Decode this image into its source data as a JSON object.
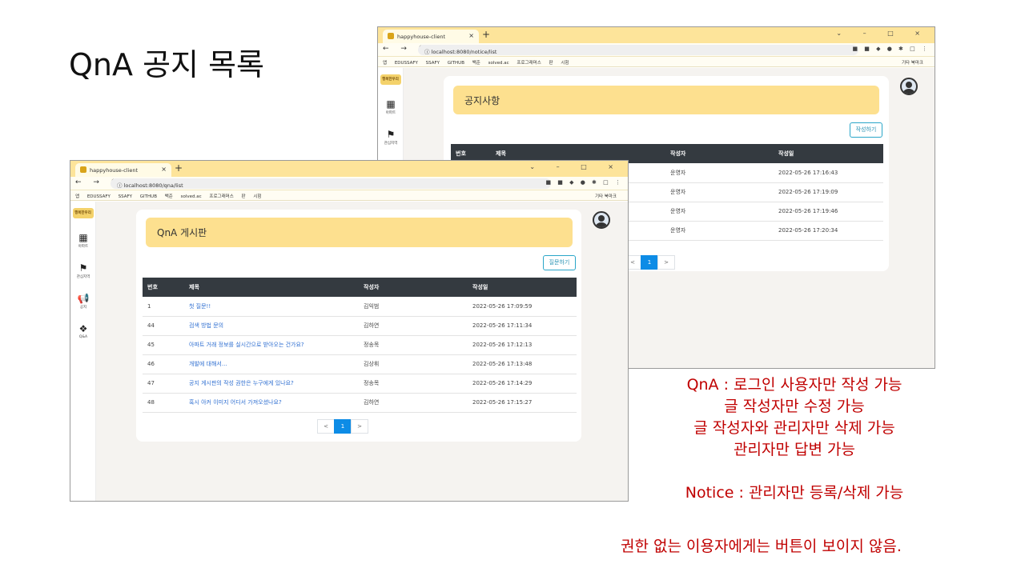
{
  "slide_title": "QnA 공지 목록",
  "notice_window": {
    "tab_title": "happyhouse-client",
    "url": "localhost:8080/notice/list",
    "bookmarks": [
      "앱",
      "EDUSSAFY",
      "SSAFY",
      "GITHUB",
      "백준",
      "solved.ac",
      "프로그래머스",
      "판",
      "시험"
    ],
    "bookmarks_right": "기타 북마크",
    "sidebar": [
      {
        "label": "아파트"
      },
      {
        "label": "관심지역"
      }
    ],
    "logo_text": "행복한우리",
    "heading": "공지사항",
    "action_button": "작성하기",
    "columns": [
      "번호",
      "제목",
      "작성자",
      "작성일"
    ],
    "rows": [
      {
        "author": "운영자",
        "date": "2022-05-26 17:16:43"
      },
      {
        "author": "운영자",
        "date": "2022-05-26 17:19:09"
      },
      {
        "author": "운영자",
        "date": "2022-05-26 17:19:46"
      },
      {
        "author": "운영자",
        "date": "2022-05-26 17:20:34"
      }
    ],
    "pager": {
      "prev": "<",
      "page": "1",
      "next": ">"
    }
  },
  "qna_window": {
    "tab_title": "happyhouse-client",
    "url": "localhost:8080/qna/list",
    "bookmarks": [
      "앱",
      "EDUSSAFY",
      "SSAFY",
      "GITHUB",
      "백준",
      "solved.ac",
      "프로그래머스",
      "판",
      "시험"
    ],
    "bookmarks_right": "기타 북마크",
    "sidebar": [
      {
        "label": "아파트"
      },
      {
        "label": "관심지역"
      },
      {
        "label": "공지"
      },
      {
        "label": "Q&A"
      }
    ],
    "logo_text": "행복한우리",
    "heading": "QnA 게시판",
    "action_button": "질문하기",
    "columns": [
      "번호",
      "제목",
      "작성자",
      "작성일"
    ],
    "rows": [
      {
        "no": "1",
        "title": "첫 질문!!",
        "author": "김익범",
        "date": "2022-05-26 17:09:59"
      },
      {
        "no": "44",
        "title": "검색 방법 문의",
        "author": "김하연",
        "date": "2022-05-26 17:11:34"
      },
      {
        "no": "45",
        "title": "아파트 거래 정보를 실시간으로 받아오는 건가요?",
        "author": "정송목",
        "date": "2022-05-26 17:12:13"
      },
      {
        "no": "46",
        "title": "개발에 대해서...",
        "author": "김상휘",
        "date": "2022-05-26 17:13:48"
      },
      {
        "no": "47",
        "title": "공지 게시판의 작성 권한은 누구에게 있나요?",
        "author": "정송목",
        "date": "2022-05-26 17:14:29"
      },
      {
        "no": "48",
        "title": "혹시 아커 이미지 어디서 가져오셨나요?",
        "author": "김하연",
        "date": "2022-05-26 17:15:27"
      }
    ],
    "pager": {
      "prev": "<",
      "page": "1",
      "next": ">"
    }
  },
  "notes": {
    "line1": "QnA : 로그인 사용자만 작성 가능",
    "line2": "글 작성자만 수정 가능",
    "line3": "글 작성자와 관리자만 삭제 가능",
    "line4": "관리자만 답변 가능",
    "line5": "Notice : 관리자만 등록/삭제 가능",
    "footnote": "권한 없는 이용자에게는 버튼이 보이지 않음."
  },
  "colors": {
    "accent_yellow": "#fde08f",
    "table_header": "#343a40",
    "note_red": "#c00000",
    "page_active": "#0d8ce6"
  }
}
